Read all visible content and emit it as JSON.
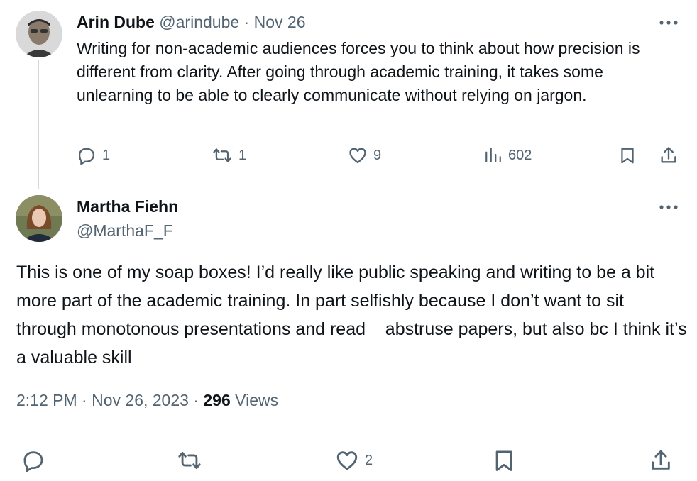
{
  "reply_post": {
    "author_name": "Arin Dube",
    "author_handle": "@arindube",
    "separator": "·",
    "date": "Nov 26",
    "body": "Writing for non-academic audiences forces you to think about how precision is different from clarity. After going through academic training, it takes some unlearning to be able to clearly communicate without relying on jargon.",
    "actions": {
      "reply_count": "1",
      "repost_count": "1",
      "like_count": "9",
      "views_count": "602"
    },
    "icons": [
      "more-icon",
      "reply-icon",
      "repost-icon",
      "like-icon",
      "views-icon",
      "bookmark-icon",
      "share-icon"
    ]
  },
  "main_post": {
    "author_name": "Martha Fiehn",
    "author_handle": "@MarthaF_F",
    "body": "This is one of my soap boxes! I’d really like public speaking and writing to be a bit more part of the academic training. In part selfishly because I don’t want to sit through monotonous presentations and read    abstruse papers, but also bc I think it’s a valuable skill",
    "time": "2:12 PM",
    "separator": "·",
    "date": "Nov 26, 2023",
    "views_number": "296",
    "views_label": "Views",
    "actions": {
      "like_count": "2"
    }
  },
  "colors": {
    "text": "#0f1419",
    "muted": "#536471",
    "thread_line": "#cfd9de",
    "divider": "#eff3f4"
  }
}
